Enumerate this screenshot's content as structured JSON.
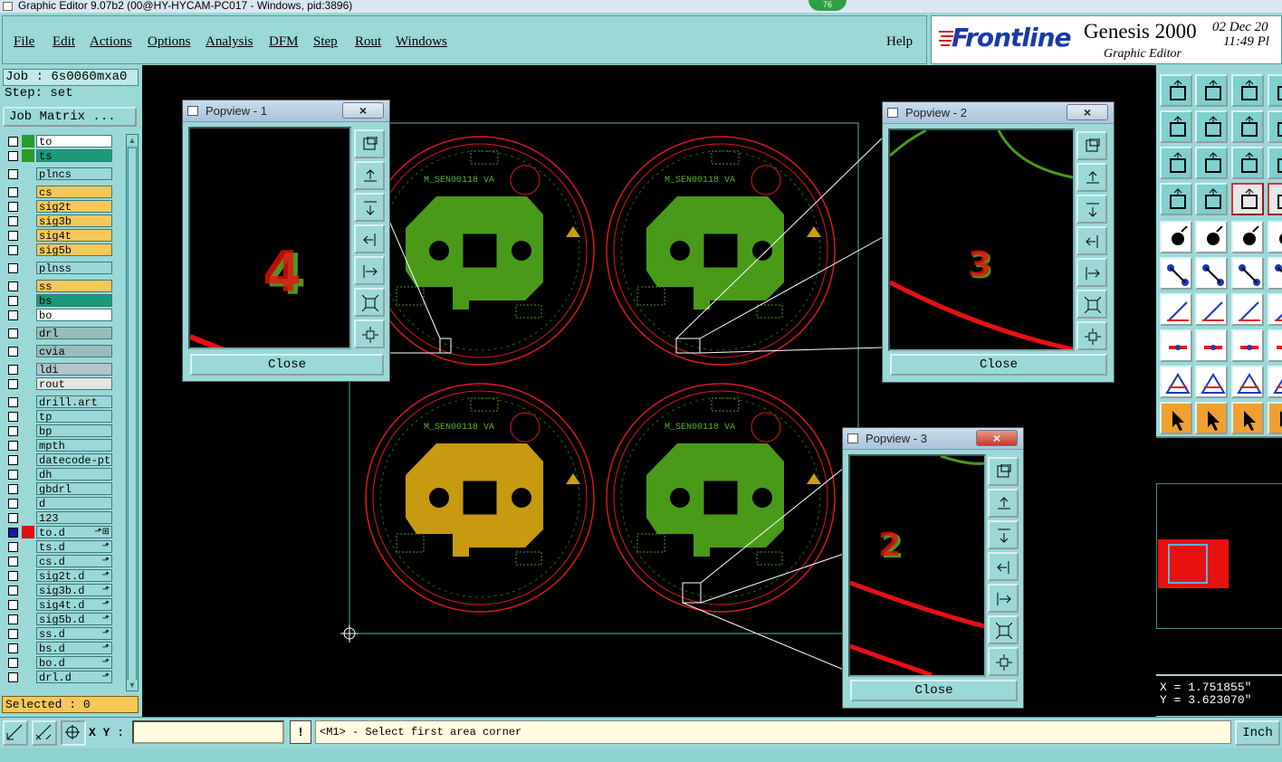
{
  "window": {
    "title": "Graphic Editor 9.07b2 (00@HY-HYCAM-PC017 - Windows, pid:3896)",
    "badge": "76"
  },
  "menu": {
    "items": [
      "File",
      "Edit",
      "Actions",
      "Options",
      "Analysis",
      "DFM",
      "Step",
      "Rout",
      "Windows"
    ],
    "help": "Help"
  },
  "brand": {
    "company": "Frontline",
    "product": "Genesis 2000",
    "subtitle": "Graphic Editor",
    "date": "02 Dec 20",
    "time": "11:49 Pl"
  },
  "job": {
    "job_label": "Job : 6s0060mxa0",
    "step_label": "Step: set",
    "matrix_button": "Job Matrix ..."
  },
  "layers": [
    {
      "name": "to",
      "color": "#2a9a2a",
      "bg": "#ffffff",
      "on": false
    },
    {
      "name": "ts",
      "color": "#2a9a2a",
      "bg": "#1a9a7a",
      "on": false
    },
    {
      "name": "plncs",
      "color": "",
      "bg": "#9bd8d8",
      "on": false
    },
    {
      "name": "cs",
      "color": "",
      "bg": "#f6c85a",
      "on": false
    },
    {
      "name": "sig2t",
      "color": "",
      "bg": "#f6c85a",
      "on": false
    },
    {
      "name": "sig3b",
      "color": "",
      "bg": "#f6c85a",
      "on": false
    },
    {
      "name": "sig4t",
      "color": "",
      "bg": "#f6c85a",
      "on": false
    },
    {
      "name": "sig5b",
      "color": "",
      "bg": "#f6c85a",
      "on": false
    },
    {
      "name": "plnss",
      "color": "",
      "bg": "#9bd8d8",
      "on": false
    },
    {
      "name": "ss",
      "color": "",
      "bg": "#f6c85a",
      "on": false
    },
    {
      "name": "bs",
      "color": "",
      "bg": "#1a9a7a",
      "on": false
    },
    {
      "name": "bo",
      "color": "",
      "bg": "#ffffff",
      "on": false
    },
    {
      "name": "drl",
      "color": "",
      "bg": "#9abcbc",
      "on": false
    },
    {
      "name": "cvia",
      "color": "",
      "bg": "#9abcbc",
      "on": false
    },
    {
      "name": "ldi",
      "color": "",
      "bg": "#b4c4cc",
      "on": false
    },
    {
      "name": "rout",
      "color": "",
      "bg": "#e4e4e4",
      "on": false
    },
    {
      "name": "drill.art",
      "color": "",
      "bg": "#9bd8d8",
      "on": false
    },
    {
      "name": "tp",
      "color": "",
      "bg": "#9bd8d8",
      "on": false
    },
    {
      "name": "bp",
      "color": "",
      "bg": "#9bd8d8",
      "on": false
    },
    {
      "name": "mpth",
      "color": "",
      "bg": "#9bd8d8",
      "on": false
    },
    {
      "name": "datecode-pt",
      "color": "",
      "bg": "#9bd8d8",
      "on": false
    },
    {
      "name": "dh",
      "color": "",
      "bg": "#9bd8d8",
      "on": false
    },
    {
      "name": "gbdrl",
      "color": "",
      "bg": "#9bd8d8",
      "on": false
    },
    {
      "name": "d",
      "color": "",
      "bg": "#9bd8d8",
      "on": false
    },
    {
      "name": "123",
      "color": "",
      "bg": "#9bd8d8",
      "on": false
    },
    {
      "name": "to.d",
      "color": "#e01010",
      "bg": "#9bd8d8",
      "on": true,
      "mark": "⬏⊞"
    },
    {
      "name": "ts.d",
      "color": "",
      "bg": "#9bd8d8",
      "on": false,
      "mark": "⬏"
    },
    {
      "name": "cs.d",
      "color": "",
      "bg": "#9bd8d8",
      "on": false,
      "mark": "⬏"
    },
    {
      "name": "sig2t.d",
      "color": "",
      "bg": "#9bd8d8",
      "on": false,
      "mark": "⬏"
    },
    {
      "name": "sig3b.d",
      "color": "",
      "bg": "#9bd8d8",
      "on": false,
      "mark": "⬏"
    },
    {
      "name": "sig4t.d",
      "color": "",
      "bg": "#9bd8d8",
      "on": false,
      "mark": "⬏"
    },
    {
      "name": "sig5b.d",
      "color": "",
      "bg": "#9bd8d8",
      "on": false,
      "mark": "⬏"
    },
    {
      "name": "ss.d",
      "color": "",
      "bg": "#9bd8d8",
      "on": false,
      "mark": "⬏"
    },
    {
      "name": "bs.d",
      "color": "",
      "bg": "#9bd8d8",
      "on": false,
      "mark": "⬏"
    },
    {
      "name": "bo.d",
      "color": "",
      "bg": "#9bd8d8",
      "on": false,
      "mark": "⬏"
    },
    {
      "name": "drl.d",
      "color": "",
      "bg": "#9bd8d8",
      "on": false,
      "mark": "⬏"
    }
  ],
  "selected": "Selected : 0",
  "board": {
    "label": "M_SEN00118 VA"
  },
  "popviews": [
    {
      "title": "Popview - 1",
      "number": "4",
      "close": "Close"
    },
    {
      "title": "Popview - 2",
      "number": "3",
      "close": "Close"
    },
    {
      "title": "Popview - 3",
      "number": "2",
      "close": "Close"
    }
  ],
  "coords": {
    "x": "X = 1.751855\"",
    "y": "Y = 3.623070\""
  },
  "status": {
    "xy_label": "X Y :",
    "xy_value": "",
    "bang": "!",
    "prompt": "<M1> - Select first area corner",
    "unit": "Inch"
  },
  "colors": {
    "panel": "#9bd8d8",
    "board_green": "#4a9a1a",
    "board_gold": "#c89a10",
    "outline_red": "#e01818",
    "highlight": "#ffd8a0"
  }
}
